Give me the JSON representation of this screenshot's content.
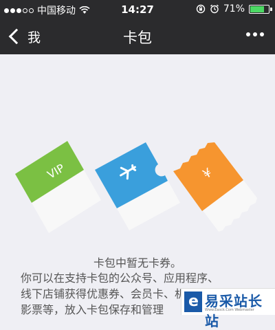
{
  "status_bar": {
    "carrier": "中国移动",
    "time": "14:27",
    "battery": "71%",
    "battery_level": 0.71,
    "icons": [
      "signal-dots-icon",
      "wifi-icon",
      "rotation-lock-icon",
      "alarm-icon",
      "battery-icon"
    ]
  },
  "nav": {
    "back_label": "我",
    "title": "卡包",
    "more_icon": "more-dots-icon"
  },
  "cards": [
    {
      "label": "VIP",
      "color": "#7bc043"
    },
    {
      "icon": "airplane-icon",
      "color": "#3a9fdc"
    },
    {
      "label": "¥",
      "color": "#f6952f"
    }
  ],
  "empty_state": {
    "title": "卡包中暂无卡券。",
    "lines": [
      "你可以在支持卡包的公众号、应用程序、",
      "线下店铺获得优惠券、会员卡、机票、电",
      "影票等，放入卡包保存和管理"
    ]
  },
  "watermark": {
    "text": "易采站长站",
    "subtext": "Www.Easck.Com Webmaster"
  }
}
